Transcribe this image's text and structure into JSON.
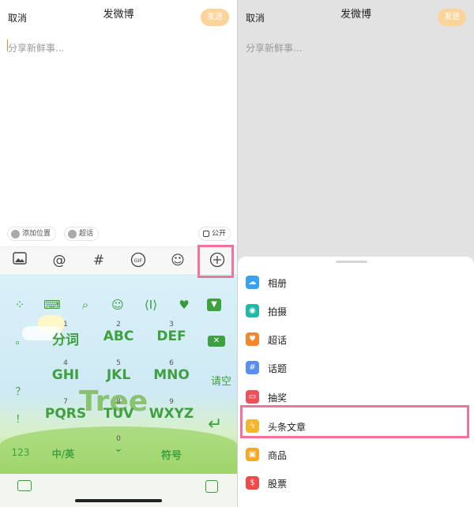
{
  "left": {
    "header": {
      "cancel": "取消",
      "title": "发微博",
      "send": "发送"
    },
    "compose_placeholder": "分享新鲜事...",
    "chips": {
      "location": "添加位置",
      "super_topic": "超话",
      "visibility": "公开"
    },
    "toolbar": [
      "image-icon",
      "at-icon",
      "hash-icon",
      "gif-icon",
      "emoji-icon",
      "plus-icon"
    ],
    "toolbar_gif_label": "GIF",
    "keyboard": {
      "keys": [
        {
          "num": "1",
          "label": "分词"
        },
        {
          "num": "2",
          "label": "ABC"
        },
        {
          "num": "3",
          "label": "DEF"
        },
        {
          "num": "4",
          "label": "GHI"
        },
        {
          "num": "5",
          "label": "JKL"
        },
        {
          "num": "6",
          "label": "MNO"
        },
        {
          "num": "7",
          "label": "PQRS"
        },
        {
          "num": "8",
          "label": "TUV"
        },
        {
          "num": "9",
          "label": "WXYZ"
        }
      ],
      "left_side": [
        "。",
        "？",
        "！"
      ],
      "clear": "请空",
      "bottom": {
        "num_key": "123",
        "lang": "中/英",
        "zero": "0",
        "symbols": "符号"
      }
    }
  },
  "right": {
    "header": {
      "cancel": "取消",
      "title": "发微博",
      "send": "发送"
    },
    "compose_placeholder": "分享新鲜事...",
    "menu": [
      {
        "label": "相册",
        "icon": "album-icon",
        "color": "#3aa0f2"
      },
      {
        "label": "拍摄",
        "icon": "camera-icon",
        "color": "#22b8a8"
      },
      {
        "label": "超话",
        "icon": "super-topic-icon",
        "color": "#f5872a"
      },
      {
        "label": "话题",
        "icon": "topic-icon",
        "color": "#5a8ef0"
      },
      {
        "label": "抽奖",
        "icon": "lottery-icon",
        "color": "#f0505a"
      },
      {
        "label": "头条文章",
        "icon": "article-icon",
        "color": "#f5b52a"
      },
      {
        "label": "商品",
        "icon": "shopping-icon",
        "color": "#f7a823"
      },
      {
        "label": "股票",
        "icon": "stock-icon",
        "color": "#ef4a4a"
      }
    ]
  },
  "colors": {
    "accent": "#f08a1c",
    "highlight": "#f0739a",
    "keyboard_green": "#3ea03e"
  }
}
